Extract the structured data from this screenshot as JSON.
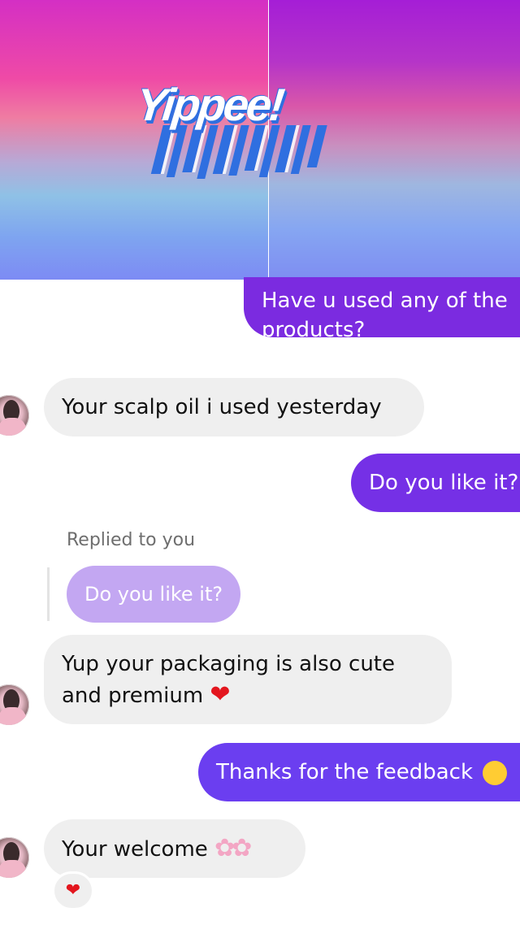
{
  "banner": {
    "logo_text": "Yippee!",
    "colors": {
      "top": "#d42fc4",
      "middle": "#ef7ca2",
      "bottom": "#7d8bf4",
      "logo_blue": "#2f6fe0"
    }
  },
  "messages": [
    {
      "id": "m1",
      "side": "sent",
      "text_line1": "Have u used  any of the",
      "text_line2": "products?"
    },
    {
      "id": "m2",
      "side": "received",
      "text": "Your scalp oil i used yesterday"
    },
    {
      "id": "m3",
      "side": "sent",
      "text": "Do you like it?"
    },
    {
      "id": "m4",
      "side": "received",
      "replied_label": "Replied to you",
      "quoted_text": "Do you like it?",
      "text_line1": "Yup your packaging is also cute",
      "text_line2": "and premium",
      "emoji": "heart-emoji"
    },
    {
      "id": "m5",
      "side": "sent",
      "text": "Thanks for the feedback",
      "emoji": "smiling-face-emoji"
    },
    {
      "id": "m6",
      "side": "received",
      "text": "Your welcome",
      "emoji": "cherry-blossom-emoji",
      "reaction": "heart-reaction"
    }
  ],
  "colors": {
    "sent_bubble": "#7b2be0",
    "sent_bubble_alt": "#6b3ef0",
    "received_bubble": "#efefef",
    "quoted_bubble": "#c3a7f2",
    "heart": "#e3161e"
  }
}
